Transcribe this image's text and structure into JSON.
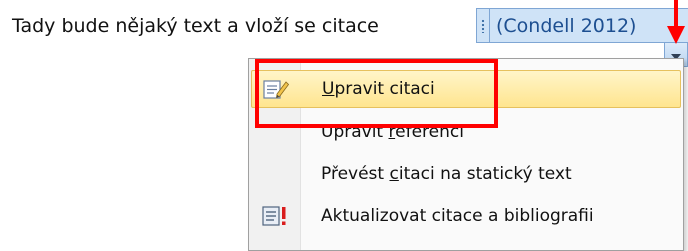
{
  "document": {
    "line_text": "Tady bude nějaký text a vloží se citace"
  },
  "citation_control": {
    "citation_text": "(Condell 2012)",
    "handle_icon": "drag-handle-icon",
    "dropdown_icon": "chevron-down-icon"
  },
  "context_menu": {
    "items": [
      {
        "label_first": "U",
        "label_rest": "pravit citaci",
        "icon": "edit-citation-icon",
        "highlighted": true
      },
      {
        "label_before": "Upravit ",
        "label_underlined": "r",
        "label_after": "eferenci",
        "icon": ""
      },
      {
        "label_before": "Převést ",
        "label_underlined": "c",
        "label_after": "itaci na statický text",
        "icon": ""
      },
      {
        "label": "Aktualizovat citace a bibliografii",
        "icon": "update-citations-icon"
      }
    ]
  },
  "annotation": {
    "color": "#ff0000",
    "arrow_icon": "red-down-arrow-icon",
    "box": "highlight-box"
  },
  "colors": {
    "highlight": "#ffe58f",
    "citation_bg": "#cfe3f7",
    "citation_text": "#1d4f91"
  }
}
